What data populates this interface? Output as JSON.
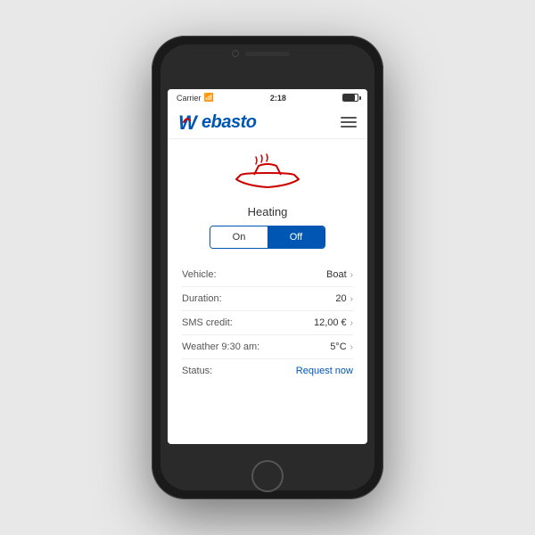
{
  "status_bar": {
    "carrier": "Carrier",
    "time": "2:18",
    "wifi": "▲"
  },
  "header": {
    "logo_text": "ebasto",
    "menu_label": "Menu"
  },
  "heating": {
    "title": "Heating",
    "toggle_on": "On",
    "toggle_off": "Off"
  },
  "info_rows": [
    {
      "label": "Vehicle:",
      "value": "Boat",
      "has_chevron": true,
      "is_link": false
    },
    {
      "label": "Duration:",
      "value": "20",
      "has_chevron": true,
      "is_link": false
    },
    {
      "label": "SMS credit:",
      "value": "12,00 €",
      "has_chevron": true,
      "is_link": false
    },
    {
      "label": "Weather 9:30 am:",
      "value": "5°C",
      "has_chevron": true,
      "is_link": false
    },
    {
      "label": "Status:",
      "value": "Request now",
      "has_chevron": false,
      "is_link": true
    }
  ],
  "colors": {
    "brand_blue": "#0056b3",
    "brand_red": "#cc0000",
    "toggle_active": "#0056b3"
  }
}
